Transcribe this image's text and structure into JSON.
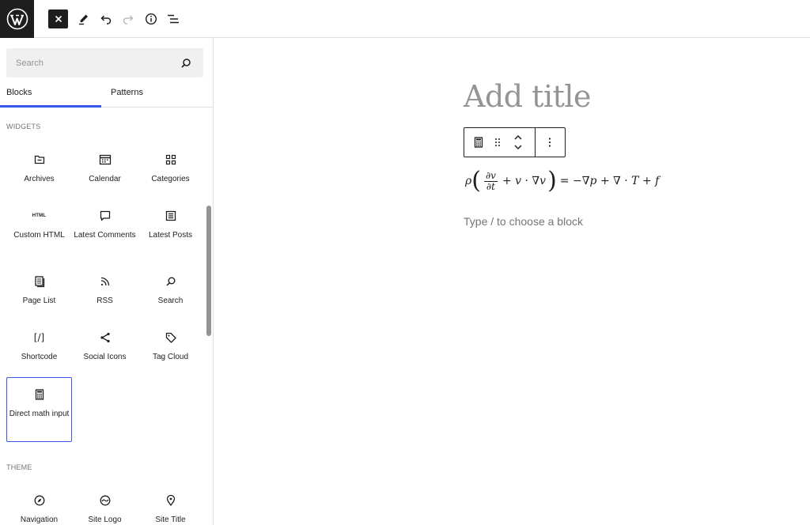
{
  "toolbar": {
    "logo_icon": "wordpress-logo",
    "close_icon": "close-icon",
    "tools_icon": "pencil-icon",
    "undo_icon": "undo-icon",
    "redo_icon": "redo-icon",
    "details_icon": "info-icon",
    "outline_icon": "list-view-icon"
  },
  "inserter": {
    "search_placeholder": "Search",
    "tabs": [
      {
        "label": "Blocks",
        "active": true
      },
      {
        "label": "Patterns",
        "active": false
      }
    ],
    "categories": [
      {
        "title": "WIDGETS",
        "blocks": [
          {
            "label": "Archives",
            "icon": "archive-icon"
          },
          {
            "label": "Calendar",
            "icon": "calendar-icon"
          },
          {
            "label": "Categories",
            "icon": "categories-icon"
          },
          {
            "label": "Custom HTML",
            "icon": "html-icon",
            "icon_text": "HTML"
          },
          {
            "label": "Latest Comments",
            "icon": "comment-icon"
          },
          {
            "label": "Latest Posts",
            "icon": "post-list-icon"
          },
          {
            "label": "Page List",
            "icon": "pages-icon"
          },
          {
            "label": "RSS",
            "icon": "rss-icon"
          },
          {
            "label": "Search",
            "icon": "search-icon"
          },
          {
            "label": "Shortcode",
            "icon": "shortcode-icon",
            "icon_text": "[/]"
          },
          {
            "label": "Social Icons",
            "icon": "share-icon"
          },
          {
            "label": "Tag Cloud",
            "icon": "tag-icon"
          },
          {
            "label": "Direct math input",
            "icon": "calculator-icon",
            "selected": true
          }
        ]
      },
      {
        "title": "THEME",
        "blocks": [
          {
            "label": "Navigation",
            "icon": "navigation-icon"
          },
          {
            "label": "Site Logo",
            "icon": "site-logo-icon"
          },
          {
            "label": "Site Title",
            "icon": "map-marker-icon"
          }
        ]
      }
    ]
  },
  "editor": {
    "title_placeholder": "Add title",
    "block_toolbar": {
      "block_icon": "calculator-icon",
      "drag_icon": "drag-handle-icon",
      "move_icon": "move-up-down-icon",
      "options_icon": "more-vertical-icon"
    },
    "equation": "ρ(∂v/∂t + v · ∇v) = −∇p + ∇ · T + f",
    "equation_parts": {
      "rho": "ρ",
      "num": "∂v",
      "den": "∂t",
      "rest_inner": "+ v · ∇v",
      "rhs": "= −∇p + ∇ · T + f"
    },
    "appender_placeholder": "Type / to choose a block"
  },
  "colors": {
    "accent": "#3858e9",
    "dark": "#1e1e1e",
    "muted": "#757575"
  }
}
